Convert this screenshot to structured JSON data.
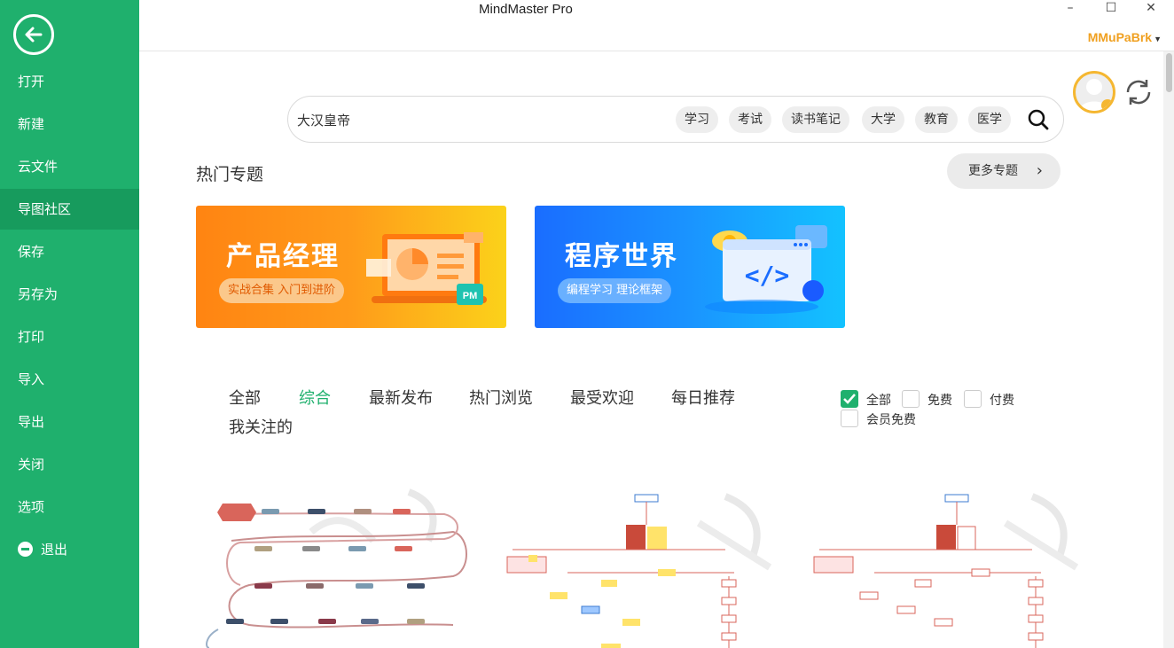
{
  "window": {
    "title": "MindMaster Pro",
    "minimize": "–",
    "maximize": "☐",
    "close": "✕",
    "user": "MMuPaBrk"
  },
  "sidebar": {
    "items": [
      "打开",
      "新建",
      "云文件",
      "导图社区",
      "保存",
      "另存为",
      "打印",
      "导入",
      "导出",
      "关闭",
      "选项"
    ],
    "exit": "退出"
  },
  "search": {
    "value": "大汉皇帝",
    "tags": [
      "学习",
      "考试",
      "读书笔记",
      "大学",
      "教育",
      "医学"
    ]
  },
  "topics": {
    "title": "热门专题",
    "more": "更多专题",
    "banners": [
      {
        "title": "产品经理",
        "subtitle": "实战合集 入门到进阶",
        "badge": "PM"
      },
      {
        "title": "程序世界",
        "subtitle": "编程学习 理论框架",
        "code": "</>"
      }
    ]
  },
  "tabs": [
    "全部",
    "综合",
    "最新发布",
    "热门浏览",
    "最受欢迎",
    "每日推荐",
    "我关注的"
  ],
  "filters": [
    "全部",
    "免费",
    "付费",
    "会员免费"
  ],
  "colors": {
    "primary": "#1fb06d",
    "accent": "#f0a020"
  }
}
